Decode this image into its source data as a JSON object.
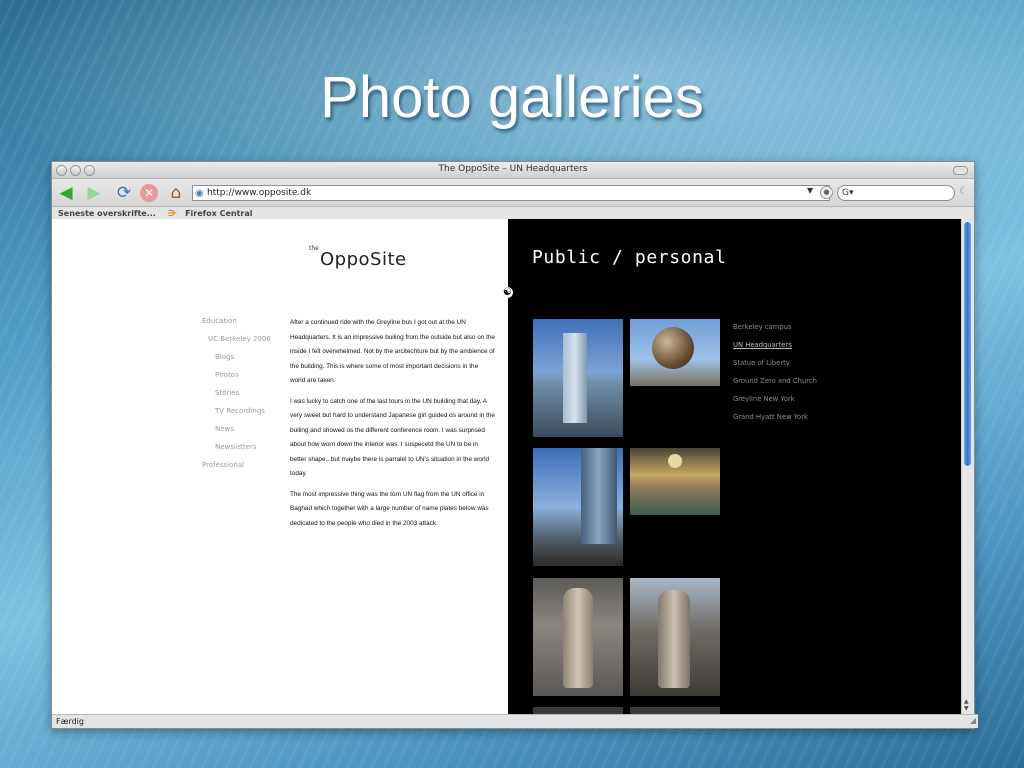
{
  "slide": {
    "title": "Photo galleries"
  },
  "browser": {
    "window_title": "The OppoSite – UN Headquarters",
    "url": "http://www.opposite.dk",
    "search_prefix": "G",
    "bookmarks": [
      "Seneste overskrifte...",
      "Firefox Central"
    ],
    "status": "Færdig"
  },
  "site": {
    "logo_small": "the",
    "logo": "OppoSite",
    "nav": [
      {
        "label": "Education",
        "level": 1
      },
      {
        "label": "UC Berkeley 2006",
        "level": 2
      },
      {
        "label": "Blogs",
        "level": 3
      },
      {
        "label": "Photos",
        "level": 3
      },
      {
        "label": "Stories",
        "level": 3
      },
      {
        "label": "TV Recordings",
        "level": 3
      },
      {
        "label": "News",
        "level": 3
      },
      {
        "label": "Newsletters",
        "level": 3
      },
      {
        "label": "Professional",
        "level": 1
      }
    ],
    "article": [
      "After a continued ride with the Greyline bus I got out at the UN Headquarters. It is an impressive builing from the outside but also on the inside I felt overwhelmed. Not by the arcitechture but by the ambience of the building. This is where some of most important decisions in the world are taken.",
      "I was lucky to catch one of the last tours in the UN building that day. A very sweet but hard to understand Japanese girl guided os around in the builing and showed os the different conference room. I was surprised about how worn down the interior was. I suspecetd the UN to be in better shape...but maybe there is parralel to UN's situation in the world today.",
      "The most impressive thing was the torn UN flag from the UN office in Baghad which together with a large number of name plates below was dedicated to the people who died in the 2003 attack."
    ],
    "right_title": "Public / personal",
    "galleries": [
      {
        "label": "Berkeley campus",
        "active": false
      },
      {
        "label": "UN Headquarters",
        "active": true
      },
      {
        "label": "Statue of Liberty",
        "active": false
      },
      {
        "label": "Ground Zero and Church",
        "active": false
      },
      {
        "label": "Greyline New York",
        "active": false
      },
      {
        "label": "Grand Hyatt New York",
        "active": false
      }
    ]
  }
}
